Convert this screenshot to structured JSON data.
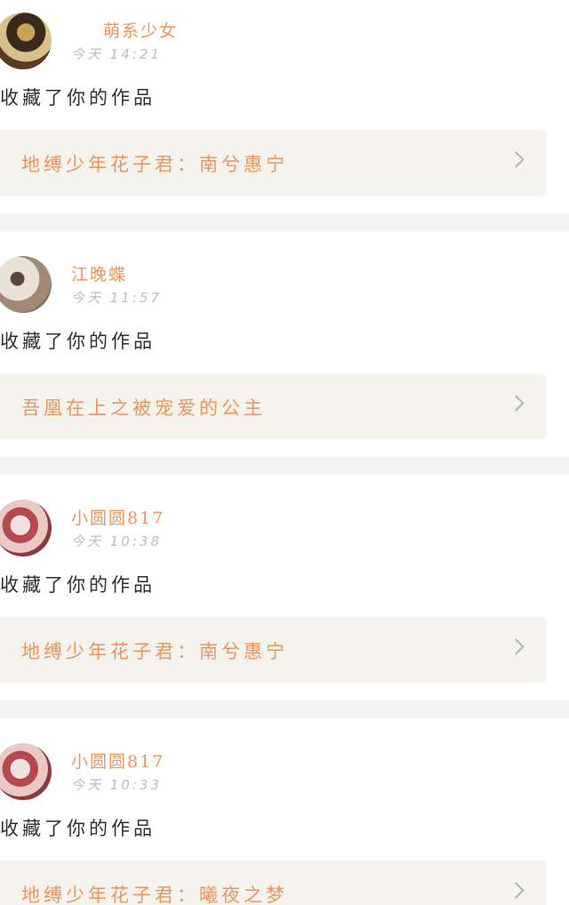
{
  "notifications": [
    {
      "username": "萌系少女",
      "time": "今天 14:21",
      "action": "收藏了你的作品",
      "work_title": "地缚少年花子君：南兮惠宁",
      "avatar_color_a": "#5a3a20",
      "avatar_color_b": "#c9a35a"
    },
    {
      "username": "江晚蝶",
      "time": "今天 11:57",
      "action": "收藏了你的作品",
      "work_title": "吾凰在上之被宠爱的公主",
      "avatar_color_a": "#8a6e5a",
      "avatar_color_b": "#e8e1d6"
    },
    {
      "username": "小圆圆817",
      "time": "今天 10:38",
      "action": "收藏了你的作品",
      "work_title": "地缚少年花子君：南兮惠宁",
      "avatar_color_a": "#b6484e",
      "avatar_color_b": "#f2e2e2"
    },
    {
      "username": "小圆圆817",
      "time": "今天 10:33",
      "action": "收藏了你的作品",
      "work_title": "地缚少年花子君：曦夜之梦",
      "avatar_color_a": "#b6484e",
      "avatar_color_b": "#f2e2e2"
    }
  ],
  "colors": {
    "accent": "#f0935a",
    "time_text": "#bdbdbd",
    "body_text": "#2f2f2f",
    "work_bg": "#f4f3ee",
    "separator": "#f4f4f4",
    "chevron": "#b3b3b3"
  },
  "icons": {
    "chevron": "chevron-right-icon"
  }
}
